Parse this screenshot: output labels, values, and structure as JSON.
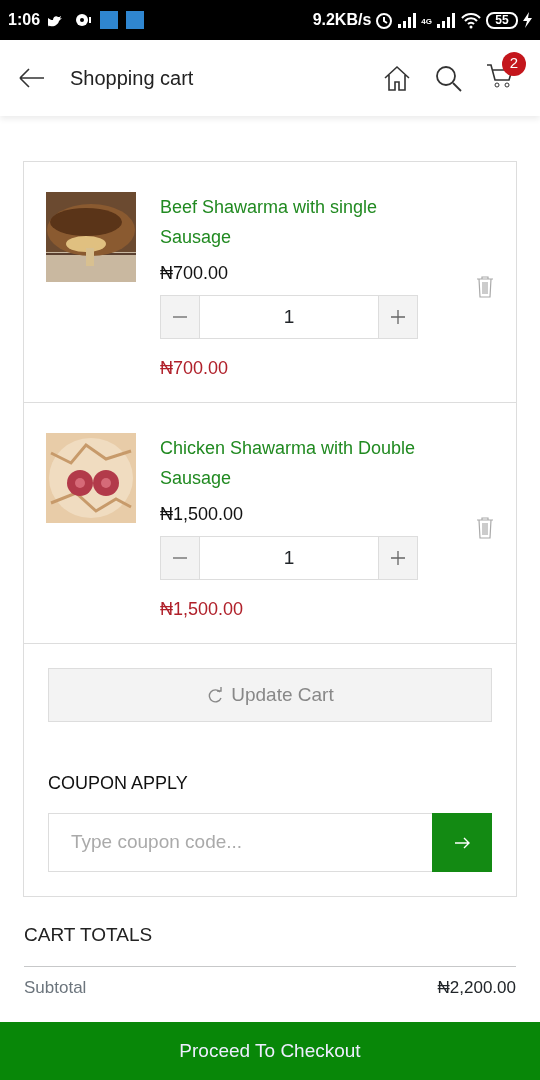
{
  "status_bar": {
    "time": "1:06",
    "network_speed": "9.2KB/s",
    "network_label": "4G",
    "battery": "55"
  },
  "app_bar": {
    "title": "Shopping cart",
    "cart_count": "2"
  },
  "items": [
    {
      "name": "Beef Shawarma with single Sausage",
      "unit_price": "₦700.00",
      "quantity": "1",
      "line_total": "₦700.00"
    },
    {
      "name": "Chicken Shawarma with Double Sausage",
      "unit_price": "₦1,500.00",
      "quantity": "1",
      "line_total": "₦1,500.00"
    }
  ],
  "update_button": "Update Cart",
  "coupon": {
    "label": "COUPON APPLY",
    "placeholder": "Type coupon code..."
  },
  "totals": {
    "title": "CART TOTALS",
    "rows": [
      {
        "label": "Subtotal",
        "value": "₦2,200.00"
      }
    ]
  },
  "checkout_button": "Proceed To Checkout"
}
